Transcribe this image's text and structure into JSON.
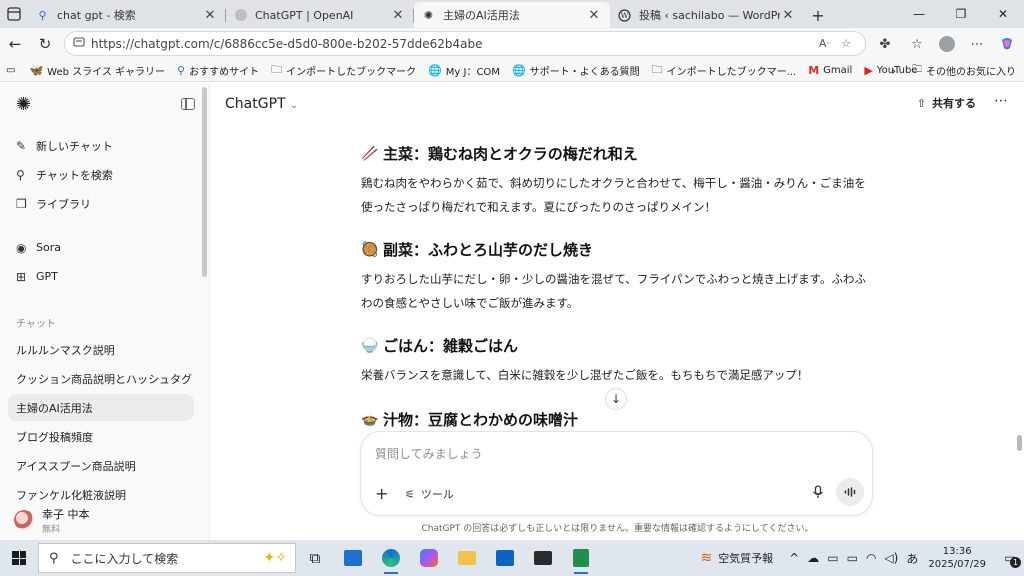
{
  "browser": {
    "tabs": [
      {
        "title": "chat gpt - 検索",
        "icon": "search-icon"
      },
      {
        "title": "ChatGPT | OpenAI",
        "icon": "openai-icon"
      },
      {
        "title": "主婦のAI活用法",
        "icon": "chatgpt-icon",
        "active": true
      },
      {
        "title": "投稿 ‹ sachilabo — WordPress",
        "icon": "wordpress-icon"
      }
    ],
    "url": "https://chatgpt.com/c/6886cc5e-d5d0-800e-b202-57dde62b4abe",
    "bookmarks": [
      {
        "label": "Web スライス ギャラリー",
        "icon": "web-slice-icon"
      },
      {
        "label": "おすすめサイト",
        "icon": "search-icon"
      },
      {
        "label": "インポートしたブックマーク",
        "icon": "folder-icon"
      },
      {
        "label": "My J：COM",
        "icon": "globe-icon"
      },
      {
        "label": "サポート・よくある質問",
        "icon": "globe-icon"
      },
      {
        "label": "インポートしたブックマー...",
        "icon": "folder-icon"
      },
      {
        "label": "Gmail",
        "icon": "gmail-icon"
      },
      {
        "label": "YouTube",
        "icon": "youtube-icon"
      }
    ],
    "other_favorites": "その他のお気に入り"
  },
  "sidebar": {
    "nav": [
      {
        "label": "新しいチャット",
        "icon": "new-chat-icon"
      },
      {
        "label": "チャットを検索",
        "icon": "search-icon"
      },
      {
        "label": "ライブラリ",
        "icon": "library-icon"
      },
      {
        "label": "Sora",
        "icon": "sora-icon"
      },
      {
        "label": "GPT",
        "icon": "gpt-grid-icon"
      }
    ],
    "chats_heading": "チャット",
    "chats": [
      {
        "label": "ルルルンマスク説明"
      },
      {
        "label": "クッション商品説明とハッシュタグ"
      },
      {
        "label": "主婦のAI活用法",
        "selected": true
      },
      {
        "label": "ブログ投稿頻度"
      },
      {
        "label": "アイススプーン商品説明"
      },
      {
        "label": "ファンケル化粧液説明"
      }
    ],
    "user": {
      "name": "幸子 中本",
      "plan": "無料"
    }
  },
  "main": {
    "model_title": "ChatGPT",
    "share_label": "共有する",
    "sections": [
      {
        "emoji": "🥢",
        "heading": "主菜：鶏むね肉とオクラの梅だれ和え",
        "body": "鶏むね肉をやわらかく茹で、斜め切りにしたオクラと合わせて、梅干し・醤油・みりん・ごま油を使ったさっぱり梅だれで和えます。夏にぴったりのさっぱりメイン！"
      },
      {
        "emoji": "🥘",
        "heading": "副菜：ふわとろ山芋のだし焼き",
        "body": "すりおろした山芋にだし・卵・少しの醤油を混ぜて、フライパンでふわっと焼き上げます。ふわふわの食感とやさしい味でご飯が進みます。"
      },
      {
        "emoji": "🍚",
        "heading": "ごはん：雑穀ごはん",
        "body": "栄養バランスを意識して、白米に雑穀を少し混ぜたご飯を。もちもちで満足感アップ！"
      },
      {
        "emoji": "🍲",
        "heading": "汁物：豆腐とわかめの味噌汁",
        "body": ""
      }
    ],
    "composer": {
      "placeholder": "質問してみましょう",
      "tools_label": "ツール"
    },
    "disclaimer": "ChatGPT の回答は必ずしも正しいとは限りません。重要な情報は確認するようにしてください。"
  },
  "taskbar": {
    "search_placeholder": "ここに入力して検索",
    "apps": [
      "task-view-icon",
      "store-icon",
      "edge-icon",
      "copilot-icon",
      "explorer-icon",
      "outlook-icon",
      "mail-icon",
      "excel-icon"
    ],
    "weather": "空気質予報",
    "ime": "あ",
    "time": "13:36",
    "date": "2025/07/29",
    "notifications": "1"
  }
}
